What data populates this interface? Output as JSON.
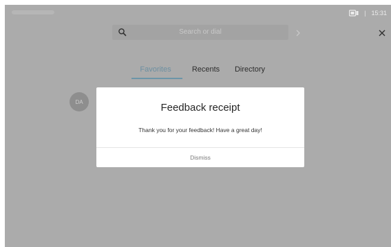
{
  "status_bar": {
    "separator": "|",
    "time": "15:31",
    "camera_icon": "camera-icon"
  },
  "search": {
    "placeholder": "Search or dial",
    "icon": "search-icon",
    "forward_icon": "chevron-right-icon",
    "close_icon": "close-icon"
  },
  "tabs": [
    {
      "label": "Favorites",
      "active": true
    },
    {
      "label": "Recents",
      "active": false
    },
    {
      "label": "Directory",
      "active": false
    }
  ],
  "contact": {
    "initials": "DA"
  },
  "modal": {
    "title": "Feedback receipt",
    "message": "Thank you for your feedback! Have a great day!",
    "dismiss_label": "Dismiss"
  },
  "colors": {
    "background_dim": "#ababab",
    "accent": "#6c95a8",
    "modal_bg": "#ffffff"
  }
}
